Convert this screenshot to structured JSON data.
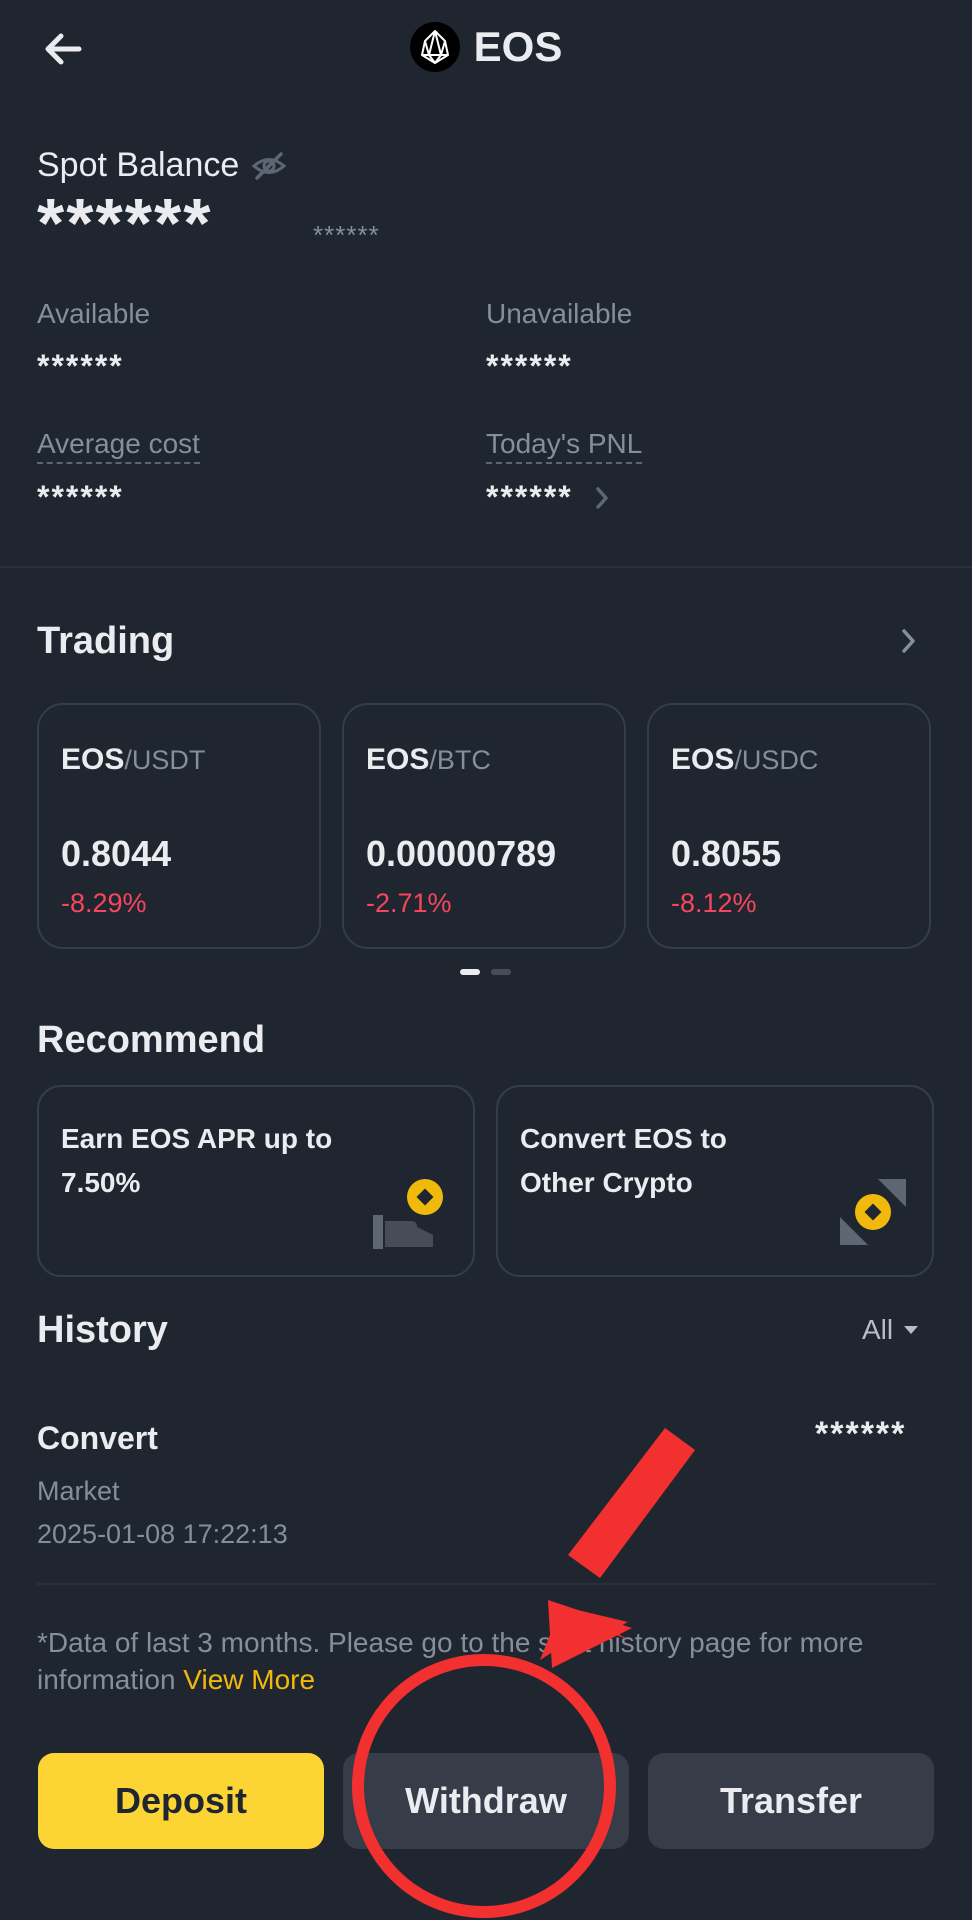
{
  "header": {
    "title": "EOS",
    "back_icon": "back-arrow-icon",
    "logo_icon": "eos-logo-icon"
  },
  "balance": {
    "label": "Spot Balance",
    "hidden_value": "******",
    "hidden_sub_value": "******",
    "available_label": "Available",
    "available_value": "******",
    "unavailable_label": "Unavailable",
    "unavailable_value": "******",
    "avg_cost_label": "Average cost",
    "avg_cost_value": "******",
    "pnl_label": "Today's PNL",
    "pnl_value": "******"
  },
  "trading": {
    "title": "Trading",
    "pairs": [
      {
        "base": "EOS",
        "quote": "/USDT",
        "price": "0.8044",
        "change": "-8.29%"
      },
      {
        "base": "EOS",
        "quote": "/BTC",
        "price": "0.00000789",
        "change": "-2.71%"
      },
      {
        "base": "EOS",
        "quote": "/USDC",
        "price": "0.8055",
        "change": "-8.12%"
      }
    ]
  },
  "recommend": {
    "title": "Recommend",
    "cards": [
      {
        "line1": "Earn EOS APR up to",
        "line2": "7.50%",
        "icon": "earn-coin-icon"
      },
      {
        "line1": "Convert EOS to",
        "line2": "Other Crypto",
        "icon": "convert-coin-icon"
      }
    ]
  },
  "history": {
    "title": "History",
    "filter": "All",
    "entries": [
      {
        "type": "Convert",
        "subtype": "Market",
        "time": "2025-01-08 17:22:13",
        "amount": "******"
      }
    ],
    "note": "*Data of last 3 months. Please go to the spot history page for more information",
    "view_more": "View More"
  },
  "actions": {
    "deposit": "Deposit",
    "withdraw": "Withdraw",
    "transfer": "Transfer"
  },
  "colors": {
    "background": "#202630",
    "accent": "#FCD535",
    "negative": "#F6465D",
    "annotation": "#F23030"
  }
}
